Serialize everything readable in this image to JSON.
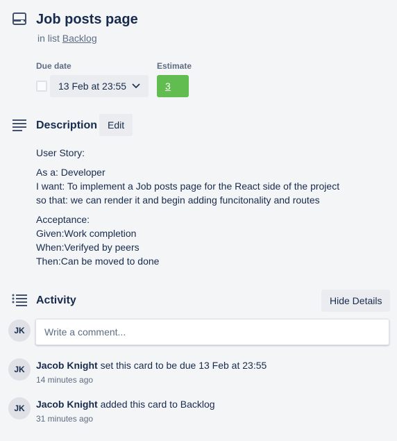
{
  "card": {
    "title": "Job posts page",
    "in_list_prefix": "in list",
    "list_name": "Backlog"
  },
  "badges": {
    "due_label": "Due date",
    "due_value": "13 Feb at 23:55",
    "estimate_label": "Estimate",
    "estimate_value": "3",
    "estimate_color": "#61bd4f"
  },
  "description": {
    "title": "Description",
    "edit_label": "Edit",
    "paragraphs": [
      [
        "User Story:"
      ],
      [
        "As a: Developer",
        "I want: To implement a Job posts page for the React side of the project",
        "so that: we can render it and begin adding funcitonality and routes"
      ],
      [
        "Acceptance:",
        "Given:Work completion",
        "When:Verifyed by peers",
        "Then:Can be moved to done"
      ]
    ]
  },
  "activity": {
    "title": "Activity",
    "hide_details_label": "Hide Details",
    "comment_placeholder": "Write a comment...",
    "user_initials": "JK",
    "entries": [
      {
        "initials": "JK",
        "user": "Jacob Knight",
        "action": "set this card to be due 13 Feb at 23:55",
        "time": "14 minutes ago"
      },
      {
        "initials": "JK",
        "user": "Jacob Knight",
        "action": "added this card to Backlog",
        "time": "31 minutes ago"
      }
    ]
  },
  "icons": {
    "card": "card-icon",
    "description": "description-icon",
    "activity": "activity-icon",
    "chevron": "chevron-down-icon"
  }
}
